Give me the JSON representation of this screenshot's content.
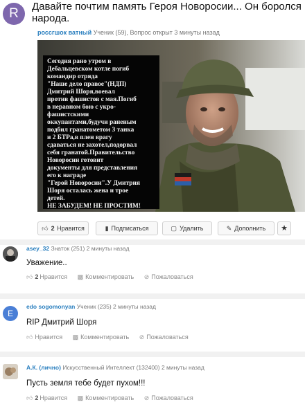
{
  "question": {
    "avatar_letter": "R",
    "title_line1": "Давайте почтим память Героя Новоросии... Он боролся",
    "title_line2": "народа.",
    "author": "россгшок ватный",
    "rank": "Ученик (59), Вопрос открыт 3 минуты назад",
    "image_text": "Сегодня рано утром в\nДебальцевском котле погиб\nкомандир отряда\n\"Наше дело правое\"(НДП)\nДмитрий Шоря,воевал\nпротив фашистов с мая.Погиб\nв неравном бою с укро-\nфашистскими\nоккупантами,будучи раненым\nподбил гранатометом 3 танка\nи 2 БТРа,в плен врагу\nсдаваться не захотел,подорвал\nсебя гранатой.Правительство\nНоворосии готовит\nдокументы для представления\nего к награде\n\"Герой Новоросии\".У Дмитрия\nШоря осталась жена и трое\nдетей.\nНЕ ЗАБУДЕМ! НЕ ПРОСТИМ!"
  },
  "actions": {
    "like_count": "2",
    "like_label": "Нравится",
    "subscribe_label": "Подписаться",
    "delete_label": "Удалить",
    "add_label": "Дополнить"
  },
  "icons": {
    "like": "thumbs-up-icon",
    "subscribe": "bookmark-icon",
    "delete": "trash-icon",
    "add": "pencil-icon",
    "star": "star-icon",
    "comment": "comment-icon",
    "report": "report-icon"
  },
  "answers": [
    {
      "author": "asey_32",
      "rank": "Знаток (251) 2 минуты назад",
      "text": "Уважение..",
      "like_count": "2",
      "like_label": "Нравится",
      "comment_label": "Комментировать",
      "report_label": "Пожаловаться"
    },
    {
      "author": "edo sogomonyan",
      "avatar_letter": "E",
      "rank": "Ученик (235) 2 минуты назад",
      "text": "RIP Дмитрий Шоря",
      "like_count": "",
      "like_label": "Нравится",
      "comment_label": "Комментировать",
      "report_label": "Пожаловаться"
    },
    {
      "author": "А.К. (лично)",
      "rank": "Искусственный Интеллект (132400) 2 минуты назад",
      "text": "Пусть земля тебе будет пухом!!!",
      "like_count": "2",
      "like_label": "Нравится",
      "comment_label": "Комментировать",
      "report_label": "Пожаловаться"
    }
  ],
  "colors": {
    "author_link": "#2a7fbf",
    "avatar_r": "#7e67ad",
    "avatar_e": "#4a7fd6",
    "separator": "#f1f1f1"
  }
}
